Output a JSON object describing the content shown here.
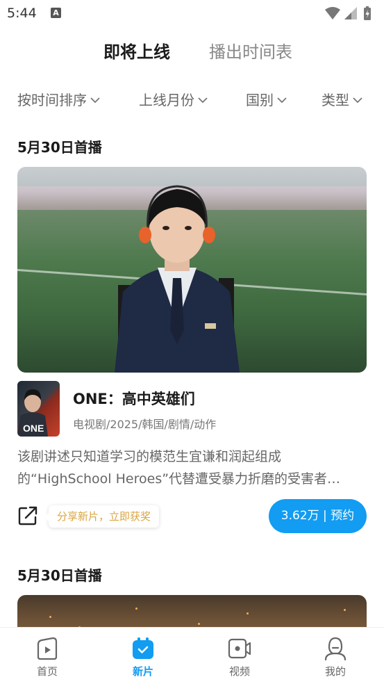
{
  "status_bar": {
    "time": "5:44",
    "notification": "A"
  },
  "top_tabs": [
    {
      "label": "即将上线",
      "active": true
    },
    {
      "label": "播出时间表",
      "active": false
    }
  ],
  "filters": [
    {
      "label": "按时间排序"
    },
    {
      "label": "上线月份"
    },
    {
      "label": "国别"
    },
    {
      "label": "类型"
    }
  ],
  "sections": [
    {
      "date": "5月30日首播",
      "show": {
        "title": "ONE：高中英雄们",
        "meta": "电视剧/2025/韩国/剧情/动作",
        "description": "该剧讲述只知道学习的模范生宜谦和润起组成的“HighSchool Heroes”代替遭受暴力折磨的受害者…",
        "thumb_label": "ONE",
        "share_tip": "分享新片，立即获奖",
        "reserve_label": "3.62万 | 预约"
      }
    },
    {
      "date": "5月30日首播"
    }
  ],
  "bottom_nav": [
    {
      "label": "首页",
      "icon": "home-play-icon",
      "active": false
    },
    {
      "label": "新片",
      "icon": "calendar-check-icon",
      "active": true
    },
    {
      "label": "视频",
      "icon": "video-camera-icon",
      "active": false
    },
    {
      "label": "我的",
      "icon": "profile-icon",
      "active": false
    }
  ],
  "colors": {
    "accent": "#129cf2",
    "share_tip_text": "#d9a441"
  }
}
